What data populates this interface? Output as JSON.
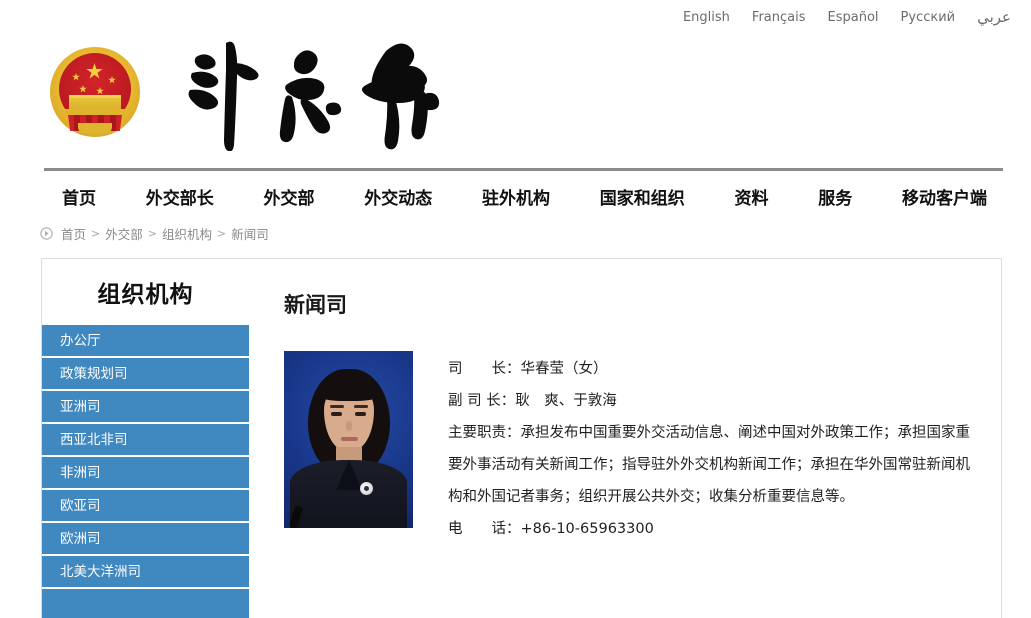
{
  "languages": [
    {
      "label": "English",
      "name": "lang-english"
    },
    {
      "label": "Français",
      "name": "lang-francais"
    },
    {
      "label": "Español",
      "name": "lang-espanol"
    },
    {
      "label": "Русский",
      "name": "lang-russian"
    },
    {
      "label": "عربي",
      "name": "lang-arabic"
    }
  ],
  "header": {
    "emblem_alt": "national-emblem",
    "wordmark": "外交部"
  },
  "nav": [
    {
      "label": "首页"
    },
    {
      "label": "外交部长"
    },
    {
      "label": "外交部"
    },
    {
      "label": "外交动态"
    },
    {
      "label": "驻外机构"
    },
    {
      "label": "国家和组织"
    },
    {
      "label": "资料"
    },
    {
      "label": "服务"
    },
    {
      "label": "移动客户端"
    }
  ],
  "breadcrumb": {
    "items": [
      "首页",
      "外交部",
      "组织机构",
      "新闻司"
    ],
    "separator": ">"
  },
  "sidebar": {
    "title": "组织机构",
    "items": [
      {
        "label": "办公厅"
      },
      {
        "label": "政策规划司"
      },
      {
        "label": "亚洲司"
      },
      {
        "label": "西亚北非司"
      },
      {
        "label": "非洲司"
      },
      {
        "label": "欧亚司"
      },
      {
        "label": "欧洲司"
      },
      {
        "label": "北美大洋洲司"
      },
      {
        "label": ""
      }
    ],
    "accent_color": "#3f88c0"
  },
  "content": {
    "title": "新闻司",
    "portrait_alt": "portrait-photo",
    "lines": [
      "司　　长：华春莹（女）",
      "副 司 长：耿　爽、于敦海",
      "主要职责：承担发布中国重要外交活动信息、阐述中国对外政策工作；承担国家重要外事活动有关新闻工作；指导驻外外交机构新闻工作；承担在华外国常驻新闻机构和外国记者事务；组织开展公共外交；收集分析重要信息等。",
      "电　　话：+86-10-65963300"
    ]
  }
}
